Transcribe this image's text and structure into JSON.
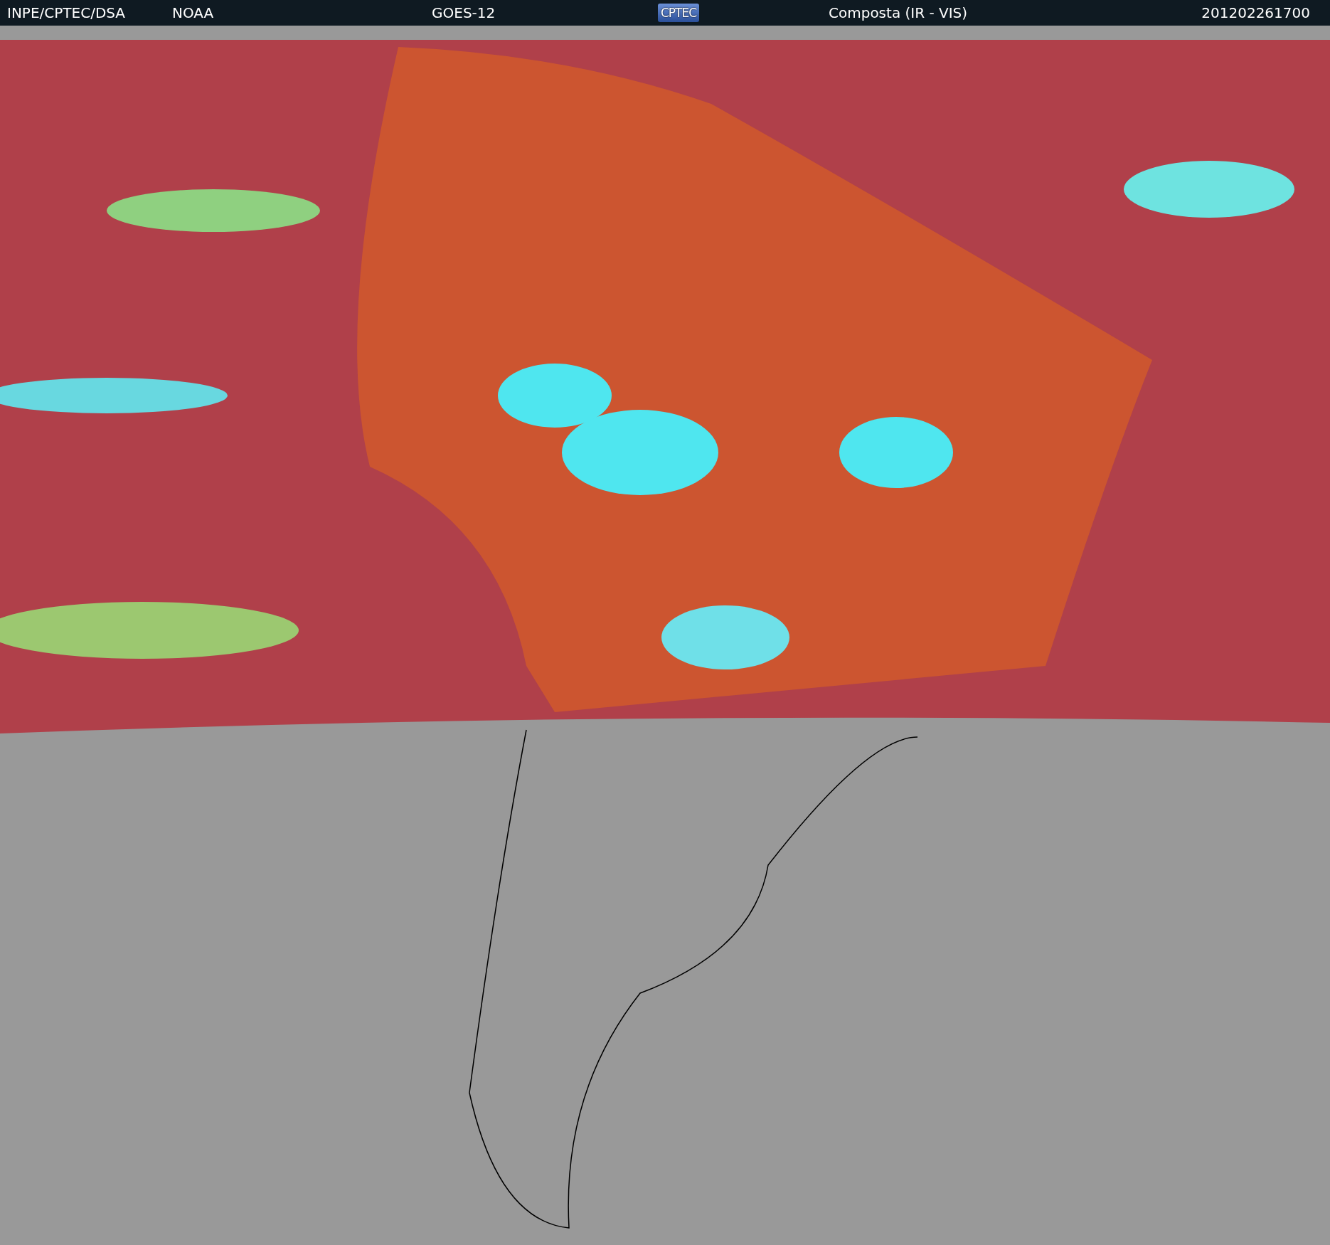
{
  "header": {
    "source": "INPE/CPTEC/DSA",
    "agency": "NOAA",
    "satellite": "GOES-12",
    "logo": "CPTEC",
    "product": "Composta (IR - VIS)",
    "timestamp": "201202261700"
  }
}
